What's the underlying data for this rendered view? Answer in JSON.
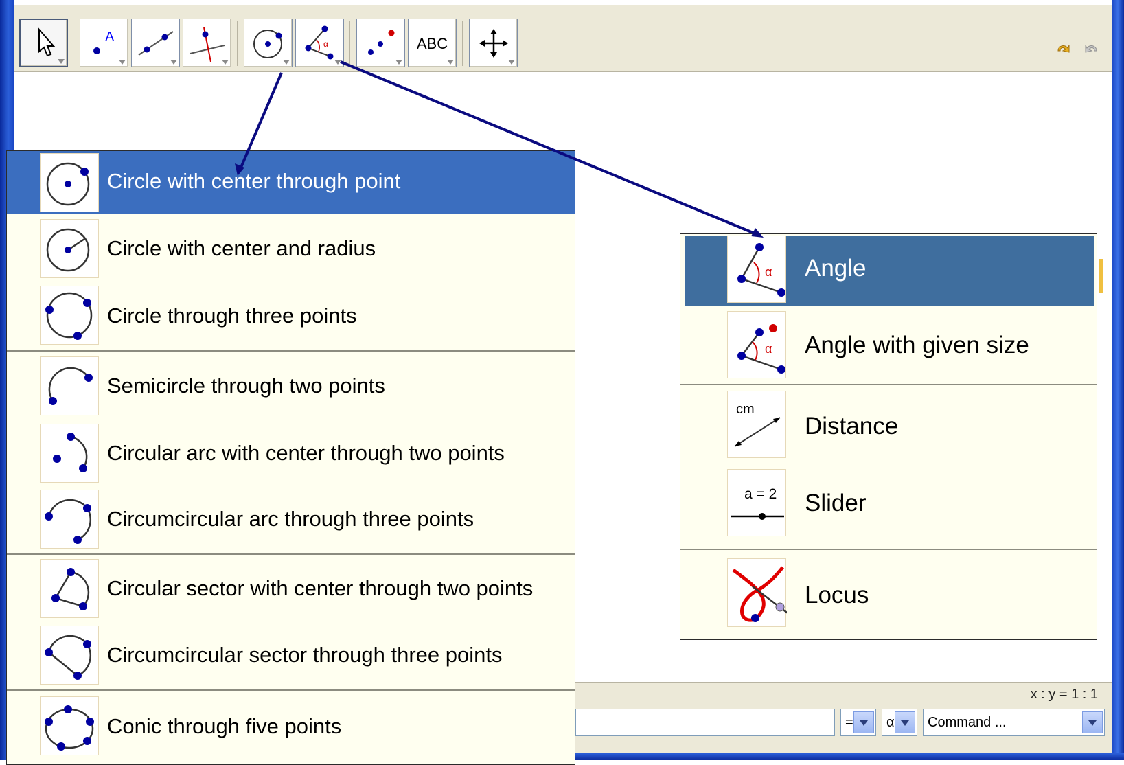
{
  "toolbar": {
    "tools": [
      {
        "name": "move-tool-button",
        "icon": "cursor-arrow-icon"
      },
      {
        "name": "new-point-button",
        "icon": "point-a-icon"
      },
      {
        "name": "line-button",
        "icon": "line-through-points-icon"
      },
      {
        "name": "perpendicular-line-button",
        "icon": "perpendicular-line-icon"
      },
      {
        "name": "circle-button",
        "icon": "circle-center-point-icon"
      },
      {
        "name": "angle-button",
        "icon": "angle-icon"
      },
      {
        "name": "reflect-button",
        "icon": "reflect-point-icon"
      },
      {
        "name": "text-button",
        "icon": "text-abc-icon",
        "label": "ABC"
      },
      {
        "name": "move-view-button",
        "icon": "move-cross-arrows-icon"
      }
    ],
    "undo_icon": "undo-icon",
    "redo_icon": "redo-icon"
  },
  "statusbar": {
    "ratio": "x : y = 1 : 1"
  },
  "inputbar": {
    "input_value": "",
    "equals_select": "=",
    "alpha_select": "α",
    "command_select": "Command ..."
  },
  "circle_menu": {
    "items": [
      {
        "label": "Circle with center through point",
        "icon": "circle-center-through-point-icon",
        "selected": true
      },
      {
        "label": "Circle with center and radius",
        "icon": "circle-center-radius-icon"
      },
      {
        "label": "Circle through three points",
        "icon": "circle-three-points-icon"
      },
      {
        "label": "Semicircle through two points",
        "icon": "semicircle-icon"
      },
      {
        "label": "Circular arc with center through two points",
        "icon": "circular-arc-icon"
      },
      {
        "label": "Circumcircular arc through three points",
        "icon": "circumcircular-arc-icon"
      },
      {
        "label": "Circular sector with center through two points",
        "icon": "circular-sector-icon"
      },
      {
        "label": "Circumcircular sector through three points",
        "icon": "circumcircular-sector-icon"
      },
      {
        "label": "Conic through five points",
        "icon": "conic-five-points-icon"
      }
    ]
  },
  "measure_menu": {
    "items": [
      {
        "label": "Angle",
        "icon": "angle-icon",
        "selected": true
      },
      {
        "label": "Angle with given size",
        "icon": "angle-given-size-icon"
      },
      {
        "label": "Distance",
        "icon": "distance-icon",
        "icon_text": "cm"
      },
      {
        "label": "Slider",
        "icon": "slider-icon",
        "icon_text": "a = 2"
      },
      {
        "label": "Locus",
        "icon": "locus-icon"
      }
    ]
  },
  "colors": {
    "selected_left": "#3b6ebf",
    "selected_right": "#3f6e9e",
    "menu_bg": "#fffff0",
    "point_blue": "#0000a0",
    "accent_red": "#d00000",
    "arrow_navy": "#0a0a80"
  }
}
